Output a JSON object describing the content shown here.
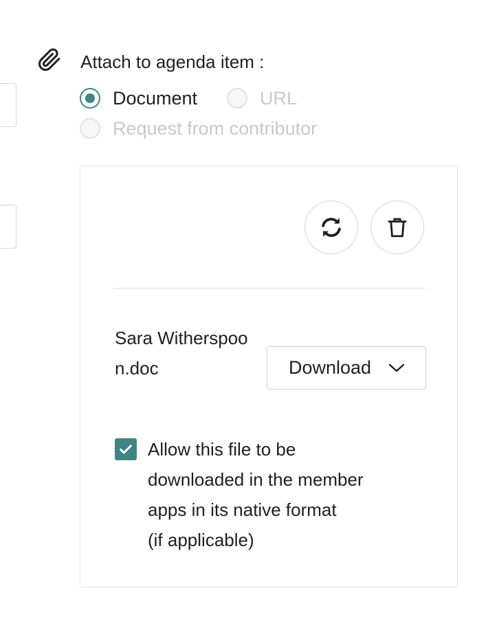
{
  "attach": {
    "label": "Attach to agenda item :",
    "icon": "paperclip-icon"
  },
  "options": {
    "document": "Document",
    "url": "URL",
    "request": "Request from contributor",
    "selected": "document"
  },
  "panel": {
    "replace_icon": "refresh-icon",
    "delete_icon": "trash-icon",
    "file_name": "Sara Witherspoon.doc",
    "download_label": "Download",
    "download_icon": "chevron-down-icon",
    "allow_download": {
      "checked": true,
      "lines": [
        "Allow this file to be",
        "downloaded in the member",
        "apps in its native format",
        "(if applicable)"
      ]
    }
  },
  "colors": {
    "accent": "#3f8583",
    "text": "#1f1f1f",
    "disabled_text": "#c9c9c9",
    "border": "#e4e4e4"
  }
}
